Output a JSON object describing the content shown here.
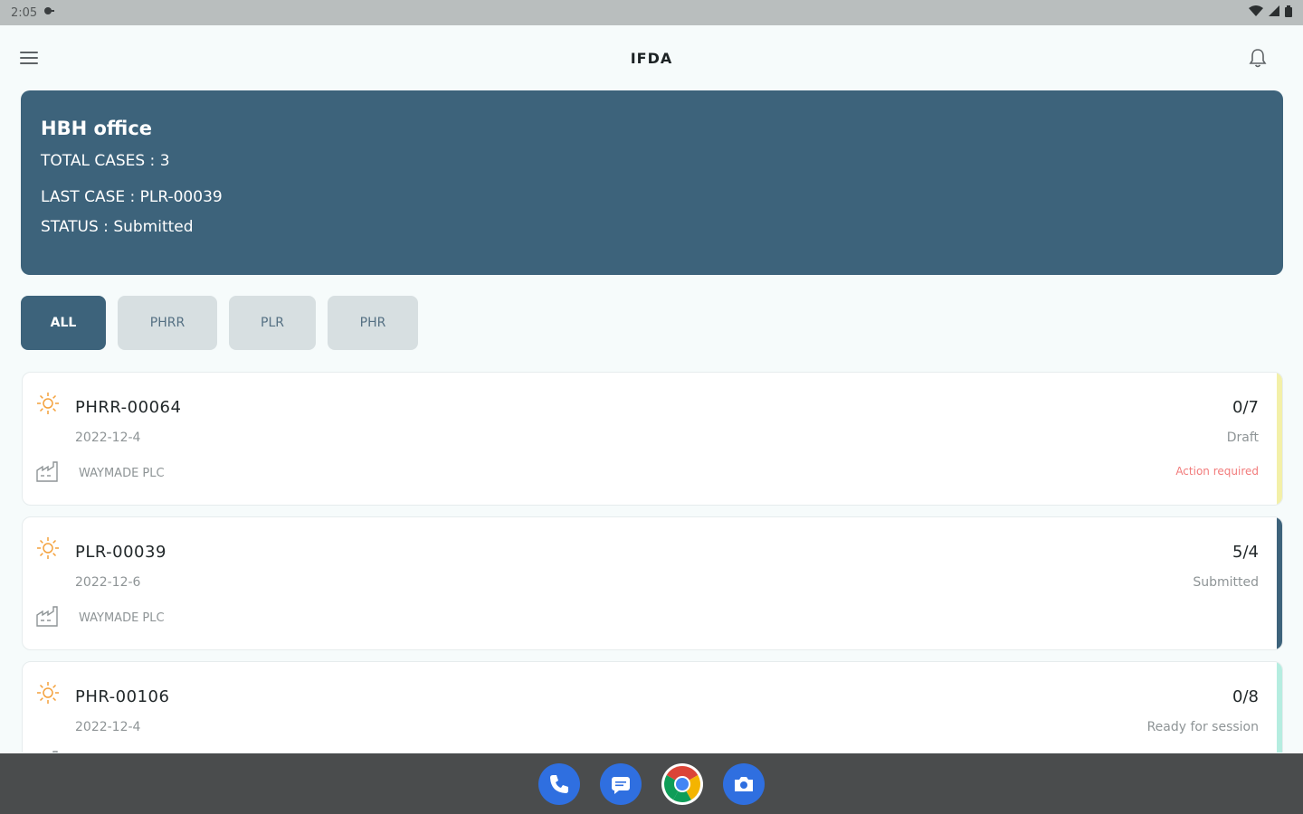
{
  "status_bar": {
    "time": "2:05"
  },
  "app_bar": {
    "title": "IFDA"
  },
  "summary": {
    "office": "HBH office",
    "total_cases": "TOTAL CASES : 3",
    "last_case": "LAST CASE : PLR-00039",
    "status": "STATUS : Submitted"
  },
  "tabs": [
    {
      "label": "ALL"
    },
    {
      "label": "PHRR"
    },
    {
      "label": "PLR"
    },
    {
      "label": "PHR"
    }
  ],
  "cases": [
    {
      "id": "PHRR-00064",
      "date": "2022-12-4",
      "company": "WAYMADE PLC",
      "ratio": "0/7",
      "status": "Draft",
      "action": "Action required",
      "accent": "#f3f0a8"
    },
    {
      "id": "PLR-00039",
      "date": "2022-12-6",
      "company": "WAYMADE PLC",
      "ratio": "5/4",
      "status": "Submitted",
      "action": "",
      "accent": "#3d637b"
    },
    {
      "id": "PHR-00106",
      "date": "2022-12-4",
      "company": "",
      "ratio": "0/8",
      "status": "Ready for session",
      "action": "",
      "accent": "#b5ede0"
    }
  ],
  "colors": {
    "primary": "#3d637b",
    "alert": "#f27b7b",
    "sun": "#f4a13c"
  },
  "dock": [
    "phone-icon",
    "messages-icon",
    "chrome-icon",
    "camera-icon"
  ]
}
